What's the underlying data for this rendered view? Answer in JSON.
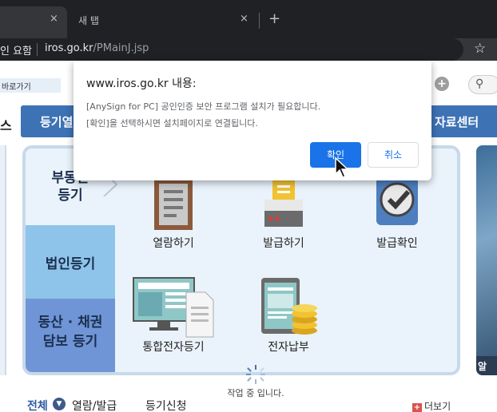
{
  "browser": {
    "active_tab": {
      "title": "",
      "close": "×"
    },
    "inactive_tab": {
      "title": "새 탭",
      "close": "×"
    },
    "new_tab": "+",
    "address": {
      "security_text": "인 요함",
      "host": "iros.go.kr",
      "path": "/PMainJ.jsp"
    },
    "bookmark_star": "☆"
  },
  "page": {
    "shortcut": "바로가기",
    "left_nav_fragment": "스",
    "nav_left_label": "등기열",
    "nav_right_label": "자료센터",
    "side_tabs": [
      {
        "line1": "부동산",
        "line2": "등기"
      },
      {
        "line1": "법인등기"
      },
      {
        "line1": "동산 · 채권",
        "line2": "담보 등기"
      }
    ],
    "services": [
      {
        "label": "열람하기",
        "icon": "document-icon"
      },
      {
        "label": "발급하기",
        "icon": "printer-icon"
      },
      {
        "label": "발급확인",
        "icon": "check-icon"
      },
      {
        "label": "통합전자등기",
        "icon": "monitor-docs-icon"
      },
      {
        "label": "전자납부",
        "icon": "tablet-coins-icon"
      }
    ],
    "right_card_text": "알",
    "loading_text": "작업 중 입니다.",
    "bottom_tabs": {
      "all": "전체",
      "tab1": "열람/발급",
      "tab2": "등기신청"
    },
    "more": "더보기",
    "more_icon": "+"
  },
  "dialog": {
    "title": "www.iros.go.kr 내용:",
    "message_line1": "[AnySign for PC] 공인인증 보안 프로그램 설치가 필요합니다.",
    "message_line2": "[확인]을 선택하시면 설치페이지로 연결됩니다.",
    "ok_label": "확인",
    "cancel_label": "취소"
  },
  "colors": {
    "chrome_dark": "#202124",
    "nav_blue": "#3d72b5",
    "ok_blue": "#1a73e8"
  }
}
